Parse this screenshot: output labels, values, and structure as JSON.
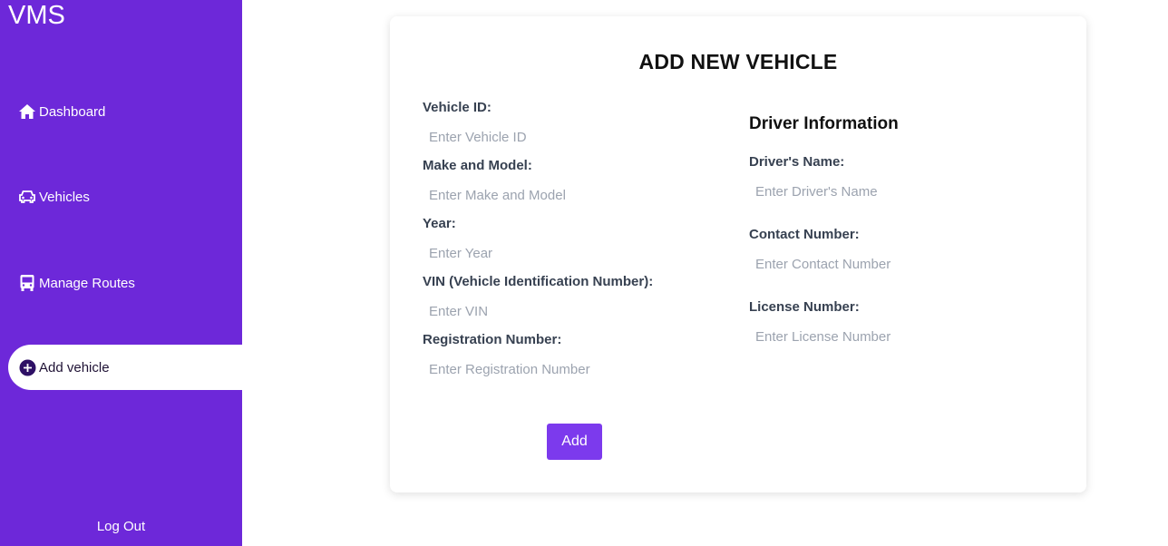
{
  "sidebar": {
    "brand": "VMS",
    "items": [
      {
        "label": "Dashboard",
        "icon": "home-icon"
      },
      {
        "label": "Vehicles",
        "icon": "car-icon"
      },
      {
        "label": "Manage Routes",
        "icon": "bus-icon"
      },
      {
        "label": "Add vehicle",
        "icon": "plus-circle-icon",
        "active": true
      }
    ],
    "logout_label": "Log Out"
  },
  "form": {
    "title": "ADD NEW VEHICLE",
    "vehicle_fields": [
      {
        "label": "Vehicle ID:",
        "placeholder": "Enter Vehicle ID",
        "value": ""
      },
      {
        "label": "Make and Model:",
        "placeholder": "Enter Make and Model",
        "value": ""
      },
      {
        "label": "Year:",
        "placeholder": "Enter Year",
        "value": ""
      },
      {
        "label": "VIN (Vehicle Identification Number):",
        "placeholder": "Enter VIN",
        "value": ""
      },
      {
        "label": "Registration Number:",
        "placeholder": "Enter Registration Number",
        "value": ""
      }
    ],
    "driver_section_title": "Driver Information",
    "driver_fields": [
      {
        "label": "Driver's Name:",
        "placeholder": "Enter Driver's Name",
        "value": ""
      },
      {
        "label": "Contact Number:",
        "placeholder": "Enter Contact Number",
        "value": ""
      },
      {
        "label": "License Number:",
        "placeholder": "Enter License Number",
        "value": ""
      }
    ],
    "submit_label": "Add"
  },
  "colors": {
    "sidebar_bg": "#6d28d9",
    "button_bg": "#7c3aed",
    "active_item_bg": "#ffffff"
  }
}
